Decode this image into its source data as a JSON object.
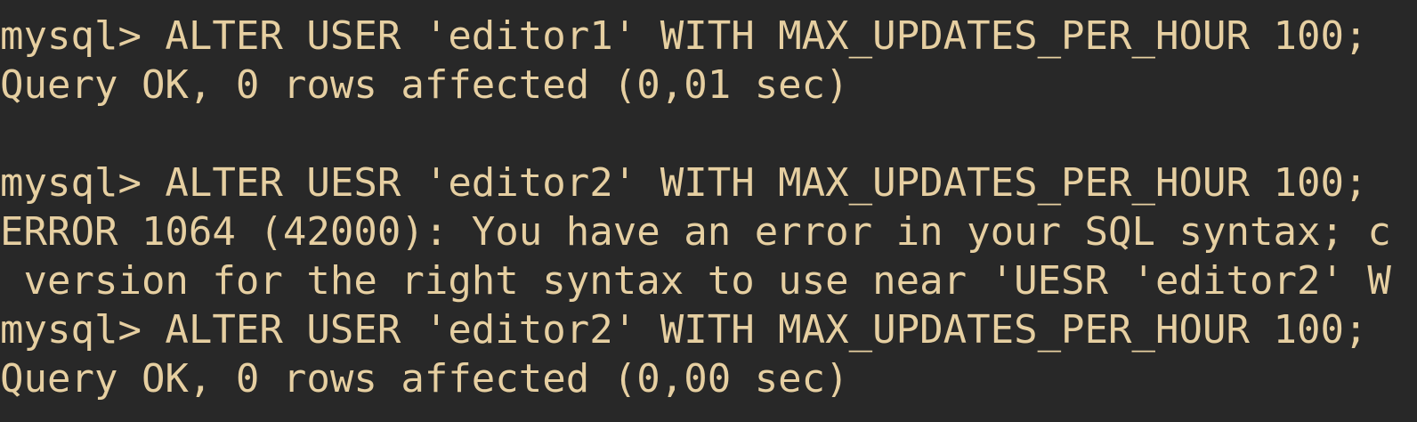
{
  "terminal": {
    "background_color": "#282828",
    "text_color": "#e6cfa1",
    "lines": [
      "mysql> ALTER USER 'editor1' WITH MAX_UPDATES_PER_HOUR 100;",
      "Query OK, 0 rows affected (0,01 sec)",
      "",
      "mysql> ALTER UESR 'editor2' WITH MAX_UPDATES_PER_HOUR 100;",
      "ERROR 1064 (42000): You have an error in your SQL syntax; c",
      " version for the right syntax to use near 'UESR 'editor2' W",
      "mysql> ALTER USER 'editor2' WITH MAX_UPDATES_PER_HOUR 100;",
      "Query OK, 0 rows affected (0,00 sec)"
    ]
  }
}
